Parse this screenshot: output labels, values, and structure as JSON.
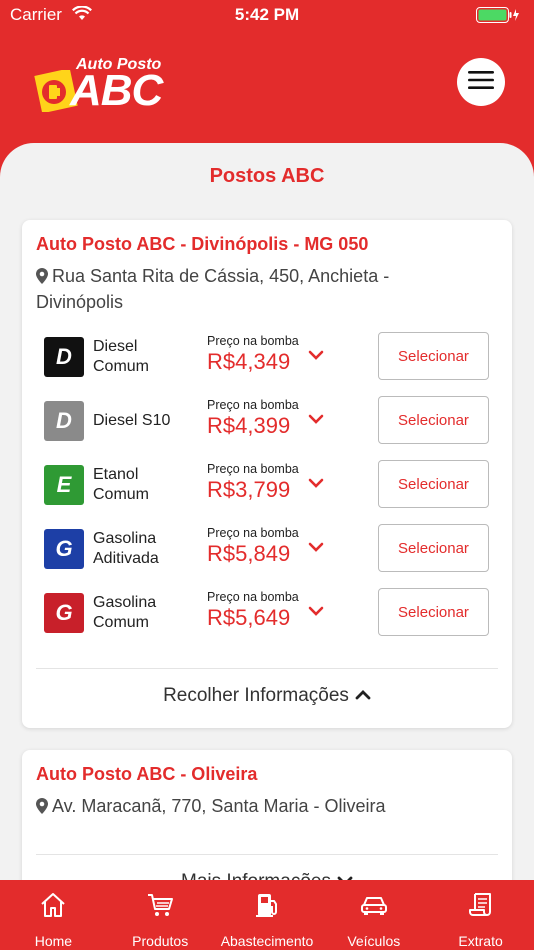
{
  "status_bar": {
    "carrier": "Carrier",
    "time": "5:42 PM"
  },
  "brand": {
    "sub": "Auto Posto",
    "main": "ABC"
  },
  "page_title": "Postos ABC",
  "stations": [
    {
      "name": "Auto Posto ABC - Divinópolis - MG 050",
      "address": "Rua Santa Rita de Cássia, 450, Anchieta - Divinópolis",
      "toggle_label": "Recolher Informações",
      "fuels": [
        {
          "letter": "D",
          "name": "Diesel Comum",
          "price_label": "Preço na bomba",
          "price": "R$4,349",
          "button": "Selecionar",
          "color": "#111111"
        },
        {
          "letter": "D",
          "name": "Diesel S10",
          "price_label": "Preço na bomba",
          "price": "R$4,399",
          "button": "Selecionar",
          "color": "#8a8a8a"
        },
        {
          "letter": "E",
          "name": "Etanol Comum",
          "price_label": "Preço na bomba",
          "price": "R$3,799",
          "button": "Selecionar",
          "color": "#2f9a34"
        },
        {
          "letter": "G",
          "name": "Gasolina Aditivada",
          "price_label": "Preço na bomba",
          "price": "R$5,849",
          "button": "Selecionar",
          "color": "#1d3fa6"
        },
        {
          "letter": "G",
          "name": "Gasolina Comum",
          "price_label": "Preço na bomba",
          "price": "R$5,649",
          "button": "Selecionar",
          "color": "#c8202a"
        }
      ]
    },
    {
      "name": "Auto Posto ABC - Oliveira",
      "address": "Av. Maracanã, 770, Santa Maria - Oliveira",
      "toggle_label": "Mais Informações"
    }
  ],
  "tabs": [
    {
      "label": "Home",
      "icon": "home-icon"
    },
    {
      "label": "Produtos",
      "icon": "cart-icon"
    },
    {
      "label": "Abastecimento",
      "icon": "fuel-pump-icon"
    },
    {
      "label": "Veículos",
      "icon": "car-icon"
    },
    {
      "label": "Extrato",
      "icon": "receipt-icon"
    }
  ],
  "colors": {
    "brand_red": "#e32c2c",
    "background": "#f2f2f2"
  }
}
